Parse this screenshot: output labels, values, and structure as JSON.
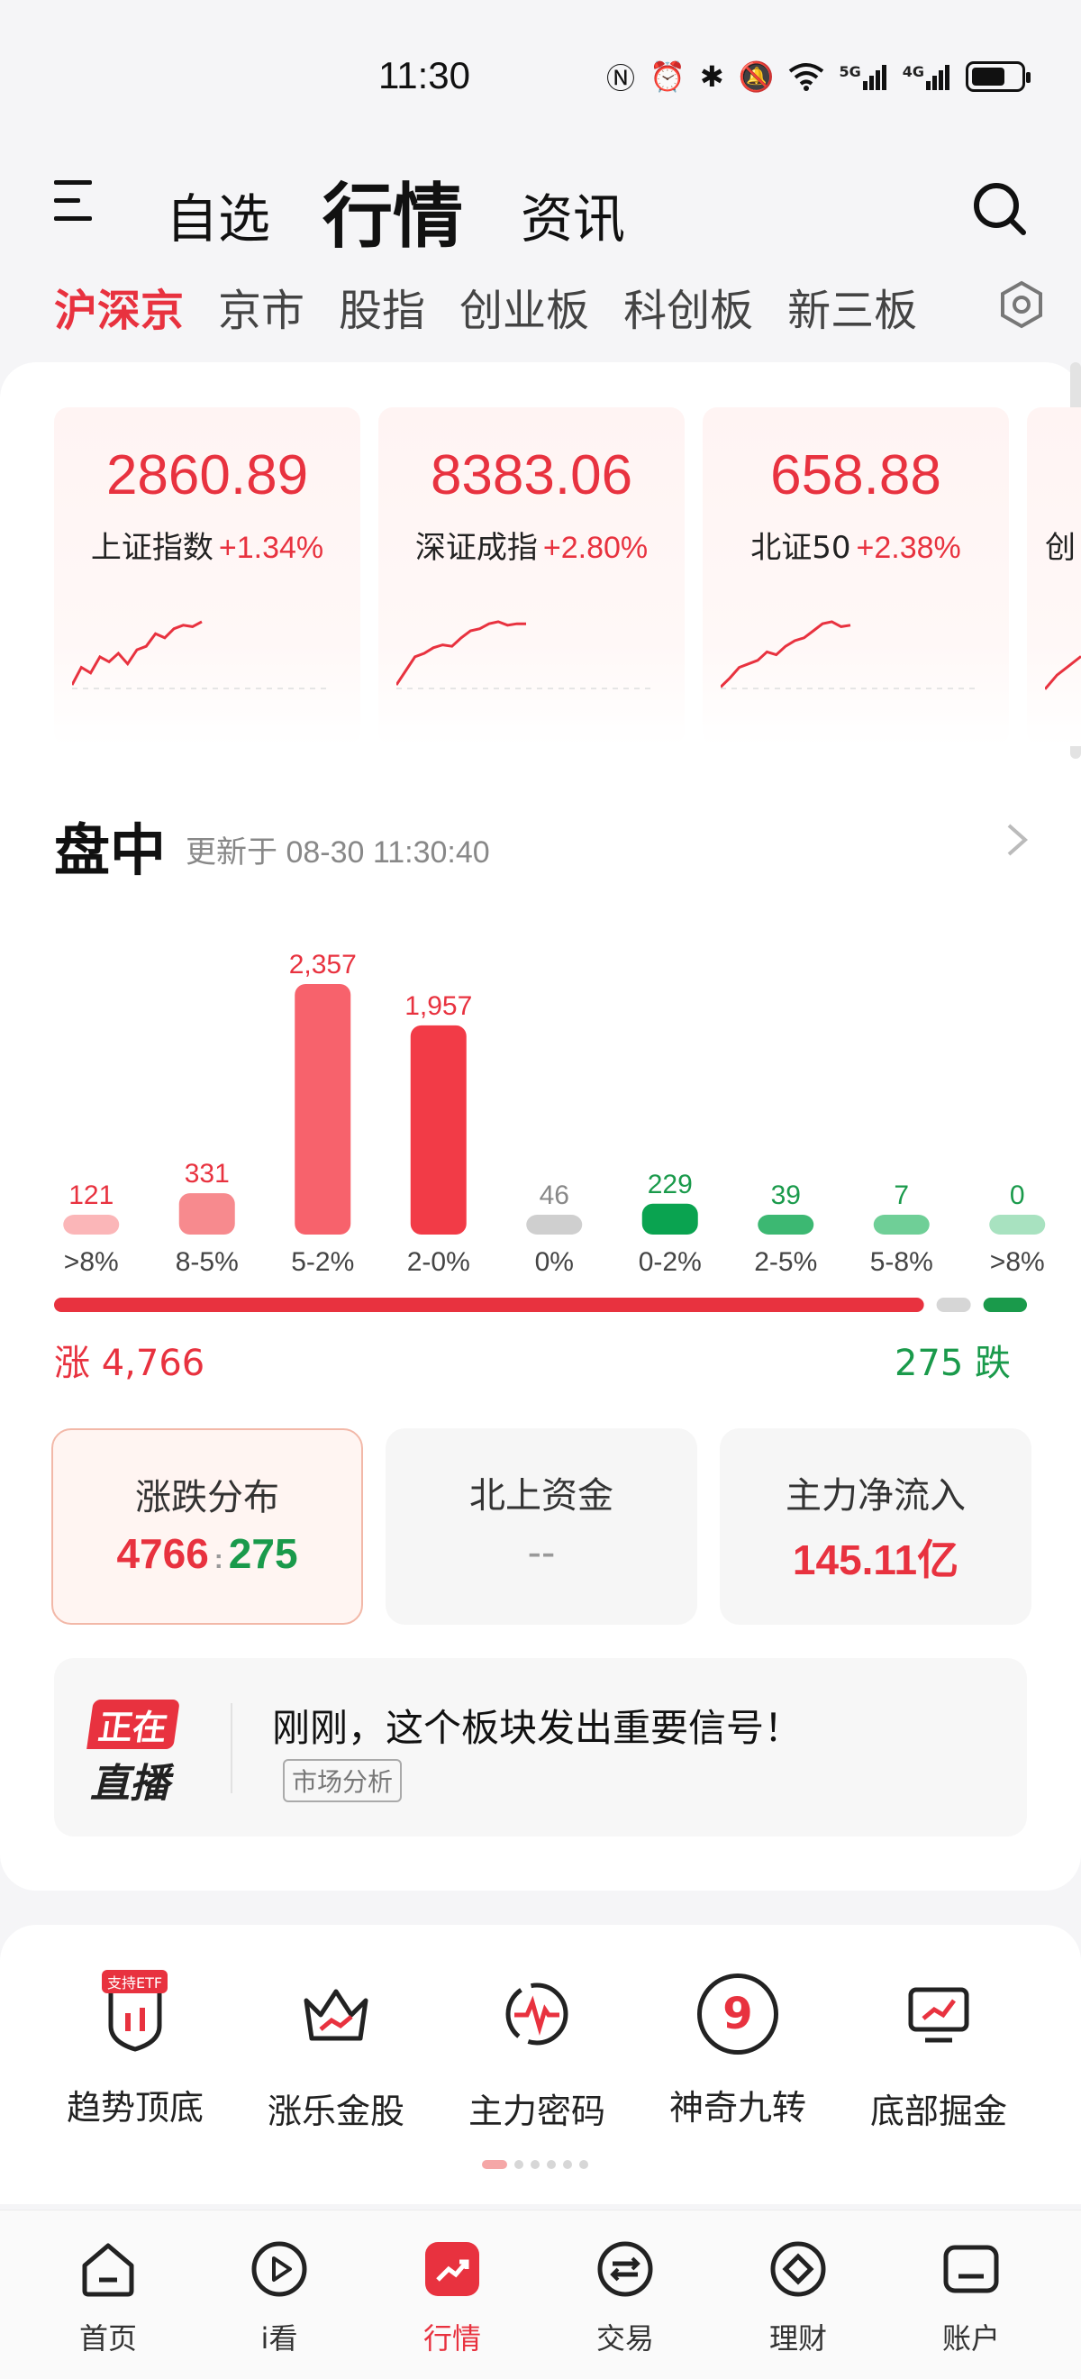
{
  "status_bar": {
    "time": "11:30",
    "icons": [
      "nfc-icon",
      "alarm-icon",
      "bluetooth-icon",
      "mute-icon",
      "wifi-icon",
      "5g-signal-icon",
      "4g-signal-icon",
      "battery-icon"
    ],
    "net_5g": "5G",
    "net_4g": "4G"
  },
  "header": {
    "tabs": [
      "自选",
      "行情",
      "资讯"
    ],
    "active_tab": "行情"
  },
  "market_tabs": [
    "沪深京",
    "京市",
    "股指",
    "创业板",
    "科创板",
    "新三板"
  ],
  "indices": [
    {
      "value": "2860.89",
      "name": "上证指数",
      "change": "+1.34%",
      "trend": [
        0.05,
        0.3,
        0.22,
        0.45,
        0.38,
        0.5,
        0.35,
        0.55,
        0.6,
        0.78,
        0.72,
        0.85,
        0.9,
        0.88,
        0.95
      ]
    },
    {
      "value": "8383.06",
      "name": "深证成指",
      "change": "+2.80%",
      "trend": [
        0.05,
        0.25,
        0.45,
        0.5,
        0.58,
        0.62,
        0.6,
        0.72,
        0.82,
        0.85,
        0.92,
        0.95,
        0.9,
        0.92,
        0.92
      ]
    },
    {
      "value": "658.88",
      "name": "北证50",
      "change": "+2.38%",
      "trend": [
        0.02,
        0.15,
        0.3,
        0.35,
        0.4,
        0.52,
        0.48,
        0.6,
        0.68,
        0.72,
        0.82,
        0.92,
        0.95,
        0.88,
        0.9
      ]
    },
    {
      "value": "",
      "name": "创",
      "change": "",
      "trend": [
        0.1,
        0.4,
        0.6,
        0.8
      ]
    }
  ],
  "intraday": {
    "title": "盘中",
    "updated": "更新于 08-30 11:30:40",
    "up_total": "涨 4,766",
    "down_total": "275 跌"
  },
  "chart_data": {
    "type": "bar",
    "categories": [
      ">8%",
      "8-5%",
      "5-2%",
      "2-0%",
      "0%",
      "0-2%",
      "2-5%",
      "5-8%",
      ">8%"
    ],
    "values": [
      121,
      331,
      2357,
      1957,
      46,
      229,
      39,
      7,
      0
    ],
    "value_labels": [
      "121",
      "331",
      "2,357",
      "1,957",
      "46",
      "229",
      "39",
      "7",
      "0"
    ],
    "colors": [
      "#fbb6b8",
      "#f78a8e",
      "#f7626c",
      "#f23b47",
      "#cfcfcf",
      "#0aa350",
      "#3cb872",
      "#6fcf97",
      "#a8e2c0"
    ],
    "label_colors": [
      "#e8323f",
      "#e8323f",
      "#e8323f",
      "#e8323f",
      "#888888",
      "#1a9a4b",
      "#1a9a4b",
      "#1a9a4b",
      "#1a9a4b"
    ],
    "ylim": [
      0,
      2357
    ]
  },
  "ratio": {
    "up": 4766,
    "flat": 46,
    "down": 275
  },
  "feature_cards": [
    {
      "title": "涨跌分布",
      "up": "4766",
      "sep": ":",
      "down": "275"
    },
    {
      "title": "北上资金",
      "value": "--"
    },
    {
      "title": "主力净流入",
      "value": "145.11亿"
    }
  ],
  "live": {
    "badge_top": "正在",
    "badge_bottom": "直播",
    "title": "刚刚，这个板块发出重要信号！",
    "tag": "市场分析"
  },
  "tools": [
    {
      "label": "趋势顶底",
      "badge": "支持ETF"
    },
    {
      "label": "涨乐金股"
    },
    {
      "label": "主力密码"
    },
    {
      "label": "神奇九转",
      "glyph": "9"
    },
    {
      "label": "底部掘金"
    }
  ],
  "nav": [
    {
      "label": "首页"
    },
    {
      "label": "i看"
    },
    {
      "label": "行情"
    },
    {
      "label": "交易"
    },
    {
      "label": "理财"
    },
    {
      "label": "账户"
    }
  ],
  "colors": {
    "up": "#e8323f",
    "down": "#1a9a4b",
    "flat": "#cfcfcf"
  }
}
